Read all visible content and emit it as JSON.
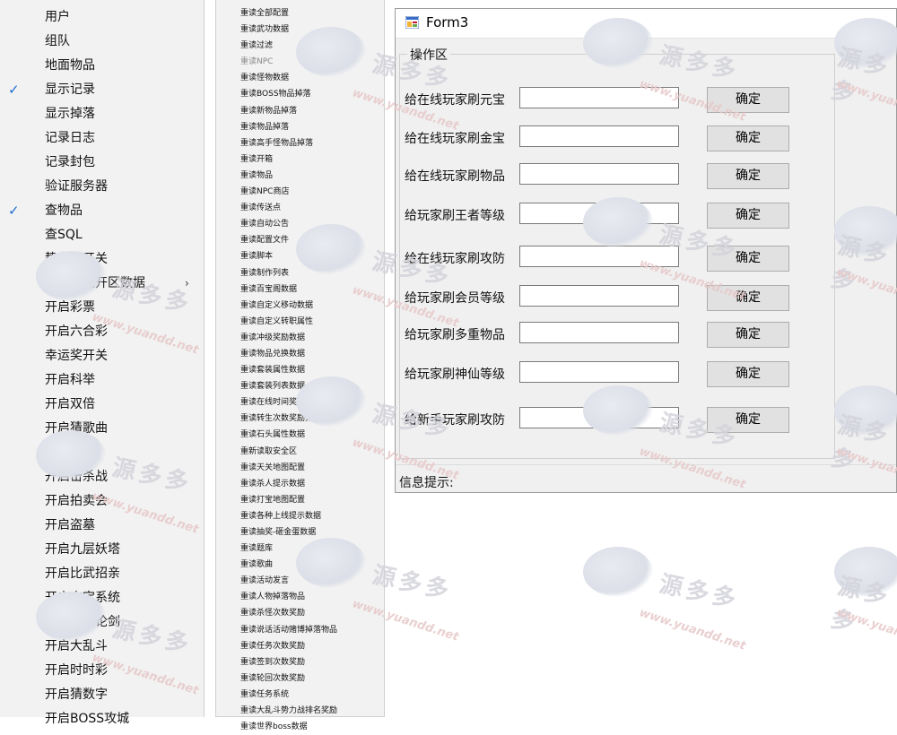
{
  "menu1": {
    "items": [
      {
        "label": "用户",
        "checked": false
      },
      {
        "label": "组队",
        "checked": false
      },
      {
        "label": "地面物品",
        "checked": false
      },
      {
        "label": "显示记录",
        "checked": true
      },
      {
        "label": "显示掉落",
        "checked": false
      },
      {
        "label": "记录日志",
        "checked": false
      },
      {
        "label": "记录封包",
        "checked": false
      },
      {
        "label": "验证服务器",
        "checked": false
      },
      {
        "label": "查物品",
        "checked": true
      },
      {
        "label": "查SQL",
        "checked": false
      },
      {
        "label": "势力战开关",
        "checked": false
      },
      {
        "label": "一键清理开区数据",
        "checked": false,
        "submenu": true
      },
      {
        "label": "开启彩票",
        "checked": false
      },
      {
        "label": "开启六合彩",
        "checked": false
      },
      {
        "label": "幸运奖开关",
        "checked": false
      },
      {
        "label": "开启科举",
        "checked": false
      },
      {
        "label": "开启双倍",
        "checked": false
      },
      {
        "label": "开启猜歌曲",
        "checked": false
      },
      {
        "label": "开启攻城",
        "checked": false
      },
      {
        "label": "开启击杀战",
        "checked": false
      },
      {
        "label": "开启拍卖会",
        "checked": false
      },
      {
        "label": "开启盗墓",
        "checked": false
      },
      {
        "label": "开启九层妖塔",
        "checked": false
      },
      {
        "label": "开启比武招亲",
        "checked": false
      },
      {
        "label": "开启夺宝系统",
        "checked": false
      },
      {
        "label": "开启华山论剑",
        "checked": false
      },
      {
        "label": "开启大乱斗",
        "checked": false
      },
      {
        "label": "开启时时彩",
        "checked": false
      },
      {
        "label": "开启猜数字",
        "checked": false
      },
      {
        "label": "开启BOSS攻城",
        "checked": false
      }
    ],
    "check_glyph": "✓",
    "submenu_glyph": "›"
  },
  "menu2": {
    "items": [
      {
        "label": "重读全部配置"
      },
      {
        "label": "重读武功数据"
      },
      {
        "label": "重读过滤"
      },
      {
        "label": "重读NPC",
        "disabled": true
      },
      {
        "label": "重读怪物数据"
      },
      {
        "label": "重读BOSS物品掉落"
      },
      {
        "label": "重读新物品掉落"
      },
      {
        "label": "重读物品掉落"
      },
      {
        "label": "重读高手怪物品掉落"
      },
      {
        "label": "重读开箱"
      },
      {
        "label": "重读物品"
      },
      {
        "label": "重读NPC商店"
      },
      {
        "label": "重读传送点"
      },
      {
        "label": "重读自动公告"
      },
      {
        "label": "重读配置文件"
      },
      {
        "label": "重读脚本"
      },
      {
        "label": "重读制作列表"
      },
      {
        "label": "重读百宝阁数据"
      },
      {
        "label": "重读自定义移动数据"
      },
      {
        "label": "重读自定义转职属性"
      },
      {
        "label": "重读冲级奖励数据"
      },
      {
        "label": "重读物品兑换数据"
      },
      {
        "label": "重读套装属性数据"
      },
      {
        "label": "重读套装列表数据"
      },
      {
        "label": "重读在线时间奖励数据"
      },
      {
        "label": "重读转生次数奖励数据"
      },
      {
        "label": "重读石头属性数据"
      },
      {
        "label": "重新读取安全区"
      },
      {
        "label": "重读天关地图配置"
      },
      {
        "label": "重读杀人提示数据"
      },
      {
        "label": "重读打宝地图配置"
      },
      {
        "label": "重读各种上线提示数据"
      },
      {
        "label": "重读抽奖-砸金蛋数据"
      },
      {
        "label": "重读题库"
      },
      {
        "label": "重读歌曲"
      },
      {
        "label": "重读活动发言"
      },
      {
        "label": "重读人物掉落物品"
      },
      {
        "label": "重读杀怪次数奖励"
      },
      {
        "label": "重读说话活动赌博掉落物品"
      },
      {
        "label": "重读任务次数奖励"
      },
      {
        "label": "重读签到次数奖励"
      },
      {
        "label": "重读轮回次数奖励"
      },
      {
        "label": "重读任务系统"
      },
      {
        "label": "重读大乱斗势力战排名奖励"
      },
      {
        "label": "重读世界boss数据"
      }
    ]
  },
  "form": {
    "title": "Form3",
    "group_title": "操作区",
    "rows": [
      {
        "label": "给在线玩家刷元宝",
        "value": "",
        "button": "确定"
      },
      {
        "label": "给在线玩家刷金宝",
        "value": "",
        "button": "确定"
      },
      {
        "label": "给在线玩家刷物品",
        "value": "",
        "button": "确定"
      },
      {
        "label": "给玩家刷王者等级",
        "value": "",
        "button": "确定"
      },
      {
        "label": "给在线玩家刷攻防",
        "value": "",
        "button": "确定"
      },
      {
        "label": "给玩家刷会员等级",
        "value": "",
        "button": "确定"
      },
      {
        "label": "给玩家刷多重物品",
        "value": "",
        "button": "确定"
      },
      {
        "label": "给玩家刷神仙等级",
        "value": "",
        "button": "确定"
      },
      {
        "label": "给新手玩家刷攻防",
        "value": "",
        "button": "确定"
      }
    ],
    "info_label": "信息提示:"
  },
  "watermark": {
    "text": "源多多",
    "url": "www.yuandd.net",
    "color": "#dcdfe8"
  },
  "colors": {
    "check": "#1f6fd0",
    "menu_bg": "#f2f2f2",
    "form_bg": "#f0f0f0",
    "button_bg": "#e1e1e1"
  }
}
